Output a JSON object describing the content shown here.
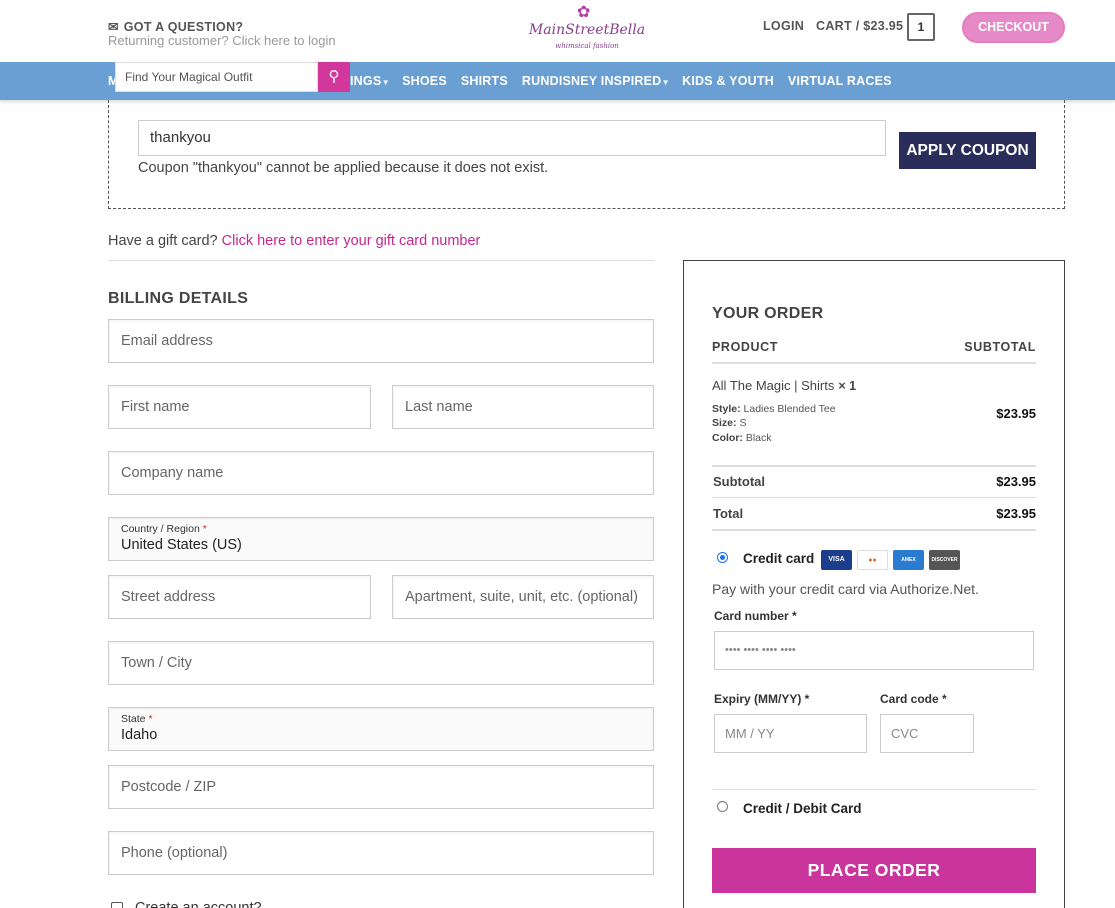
{
  "header": {
    "question": "GOT A QUESTION?",
    "returning_ghost": "Returning customer? Click here to login",
    "logo_name": "MainStreetBella",
    "logo_tag": "whimsical fashion",
    "login": "LOGIN",
    "cart": "CART / $23.95",
    "cart_count": "1",
    "checkout": "CHECKOUT"
  },
  "nav": {
    "first": "M",
    "search_placeholder": "Find Your Magical Outfit",
    "items": [
      "INGS",
      "SHOES",
      "SHIRTS",
      "RUNDISNEY INSPIRED",
      "KIDS & YOUTH",
      "VIRTUAL RACES"
    ]
  },
  "coupon": {
    "value": "thankyou",
    "message": "Coupon \"thankyou\" cannot be applied because it does not exist.",
    "apply": "APPLY COUPON"
  },
  "gift": {
    "prefix": "Have a gift card?",
    "link": "Click here to enter your gift card number"
  },
  "billing": {
    "title": "BILLING DETAILS",
    "email": "Email address",
    "first_name": "First name",
    "last_name": "Last name",
    "company": "Company name",
    "country_label": "Country / Region",
    "country_value": "United States (US)",
    "street": "Street address",
    "apartment": "Apartment, suite, unit, etc. (optional)",
    "city": "Town / City",
    "state_label": "State",
    "state_value": "Idaho",
    "postcode": "Postcode / ZIP",
    "phone": "Phone (optional)",
    "create_account": "Create an account?",
    "required": "*"
  },
  "order": {
    "title": "YOUR ORDER",
    "col_product": "PRODUCT",
    "col_subtotal": "SUBTOTAL",
    "product_name": "All The Magic | Shirts",
    "qty": "× 1",
    "style_label": "Style:",
    "style": "Ladies Blended Tee",
    "size_label": "Size:",
    "size": "S",
    "color_label": "Color:",
    "color": "Black",
    "price": "$23.95",
    "subtotal_label": "Subtotal",
    "subtotal": "$23.95",
    "total_label": "Total",
    "total": "$23.95"
  },
  "payment": {
    "credit_card": "Credit card",
    "cards": [
      "VISA",
      "MC",
      "AMEX",
      "DISCOVER"
    ],
    "description": "Pay with your credit card via Authorize.Net.",
    "card_number_label": "Card number *",
    "card_number_placeholder": "•••• •••• •••• ••••",
    "expiry_label": "Expiry (MM/YY) *",
    "expiry_placeholder": "MM / YY",
    "cvc_label": "Card code *",
    "cvc_placeholder": "CVC",
    "debit": "Credit / Debit Card",
    "place_order": "PLACE ORDER"
  },
  "colors": {
    "nav": "#6a9fd4",
    "accent": "#c9349d",
    "apply": "#2a2c5a"
  }
}
